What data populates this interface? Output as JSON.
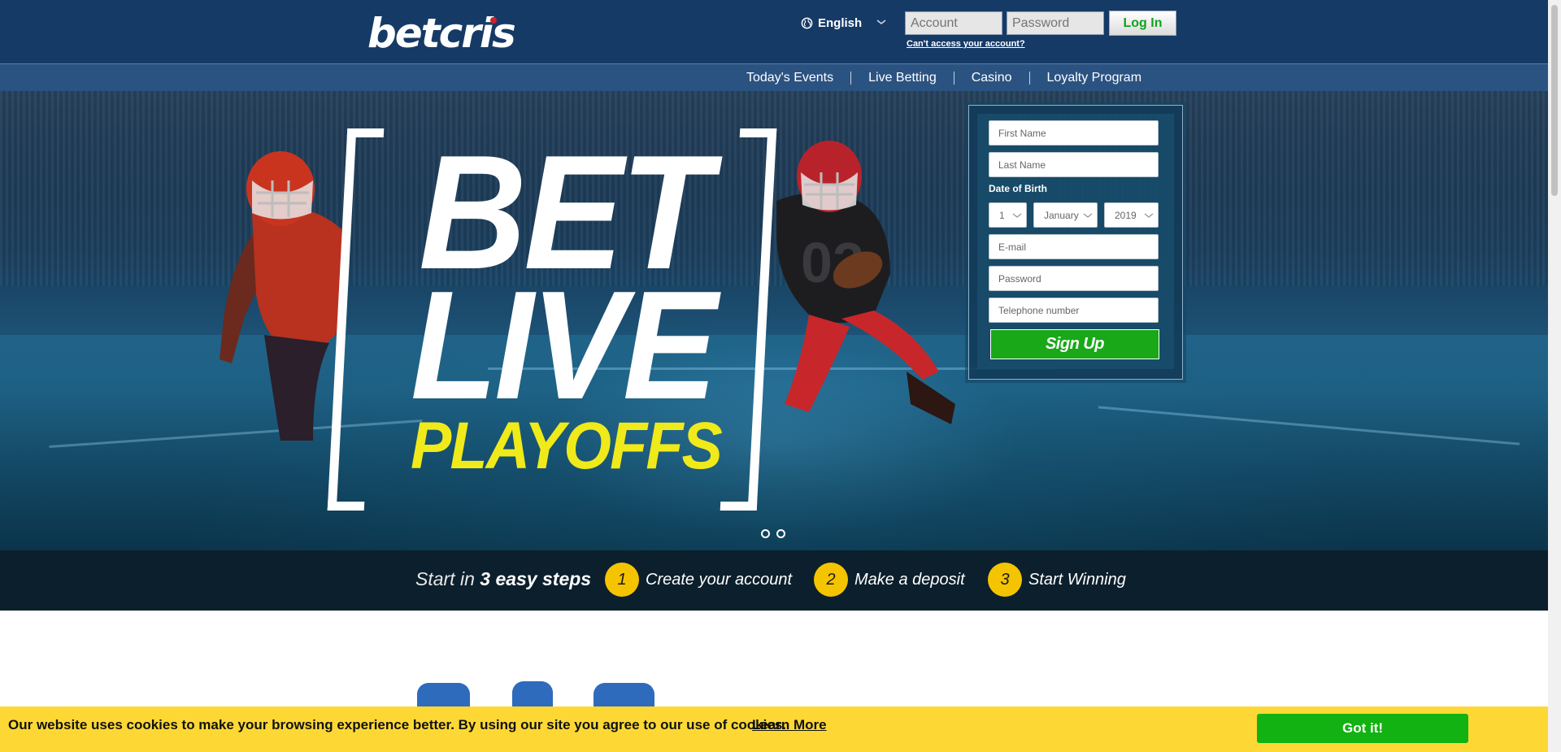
{
  "header": {
    "logo": "betcris",
    "language": "English",
    "account_placeholder": "Account",
    "password_placeholder": "Password",
    "login_label": "Log In",
    "forgot_link": "Can't access your account?"
  },
  "nav": {
    "items": [
      {
        "label": "Today's Events"
      },
      {
        "label": "Live Betting"
      },
      {
        "label": "Casino"
      },
      {
        "label": "Loyalty Program"
      }
    ]
  },
  "hero": {
    "line1": "BET",
    "line2": "LIVE",
    "line3": "PLAYOFFS",
    "slides": 2,
    "active_slide": 1
  },
  "signup": {
    "first_name": "First Name",
    "last_name": "Last Name",
    "dob_label": "Date of Birth",
    "day": "1",
    "month": "January",
    "year": "2019",
    "email": "E-mail",
    "password": "Password",
    "phone": "Telephone number",
    "button": "Sign Up"
  },
  "steps": {
    "intro_prefix": "Start in",
    "intro_bold": "3 easy steps",
    "items": [
      {
        "num": "1",
        "text": "Create your account"
      },
      {
        "num": "2",
        "text": "Make a deposit"
      },
      {
        "num": "3",
        "text": "Start Winning"
      }
    ]
  },
  "cookie": {
    "text": "Our website uses cookies to make your browsing experience better. By using our site you agree to our use of cookies.",
    "link": "Learn More",
    "button": "Got it!"
  },
  "colors": {
    "header_bg": "#163a66",
    "nav_bg": "#2b5382",
    "signup_green": "#18a818",
    "step_yellow": "#f5c400",
    "hero_yellow": "#f0ea1a",
    "cookie_bg": "#fdd835"
  },
  "icons": [
    "globe-icon",
    "chevron-down-icon"
  ]
}
